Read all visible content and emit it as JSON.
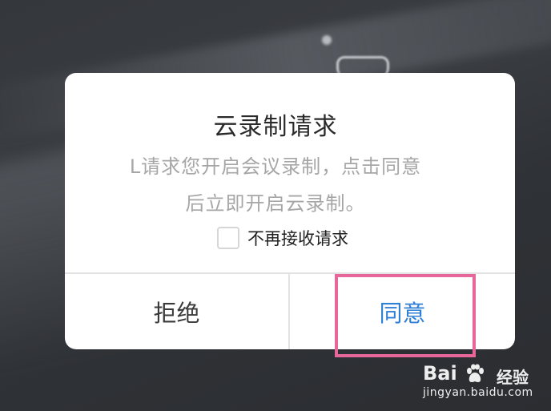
{
  "dialog": {
    "title": "云录制请求",
    "message_line1": "L请求您开启会议录制，点击同意",
    "message_line2": "后立即开启云录制。",
    "checkbox": {
      "label": "不再接收请求",
      "checked": false
    },
    "buttons": {
      "reject_label": "拒绝",
      "agree_label": "同意"
    }
  },
  "highlight": {
    "target": "agree-button",
    "color": "#e8679a"
  },
  "watermark": {
    "logo_text": "Bai",
    "logo_icon": "baidu-paw-icon",
    "product_text": "经验",
    "url": "jingyan.baidu.com"
  },
  "colors": {
    "agree": "#2f7fd6",
    "reject": "#3a3a3a",
    "title": "#2a2a2a",
    "message": "#a6a6a6",
    "background": "#34373c"
  }
}
